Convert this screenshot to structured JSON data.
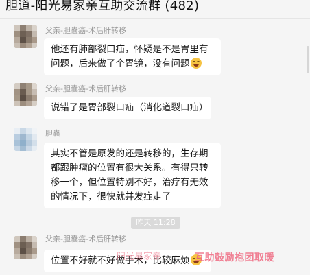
{
  "chat": {
    "title": "胆道-阳光易家亲互助交流群 (482)"
  },
  "messages": [
    {
      "sender": "父亲-胆囊癌-术后肝转移",
      "lines": [
        "他还有肺部裂口疝，怀疑是不是胃里有",
        "问题，后来做了个胃镜，没有问题"
      ],
      "emoji": "laughing-emoji"
    },
    {
      "sender": "父亲-胆囊癌-术后肝转移",
      "lines": [
        "说错了是胃部裂口疝（消化道裂口疝）"
      ]
    },
    {
      "sender": "胆囊",
      "lines": [
        "其实不管是原发的还是转移的，生存期",
        "都跟肿瘤的位置有很大关系。有得只转",
        "移一个，但位置特别不好，治疗有无效",
        "的情况下，很快就并发症走了"
      ]
    },
    {
      "sender": "父亲-胆囊癌-术后肝转移",
      "lines": [
        "位置不好就不好做手术，比较麻烦"
      ],
      "emoji": "laughing-emoji"
    }
  ],
  "timestamp": "昨天 11:28",
  "watermark": "互助鼓励抱团取暖",
  "watermark_faint": "阳光易家亲",
  "colors": {
    "background": "#f5f5f5",
    "bubble": "#ffffff",
    "sender_text": "#9a9a9a",
    "watermark": "#ef6880"
  }
}
